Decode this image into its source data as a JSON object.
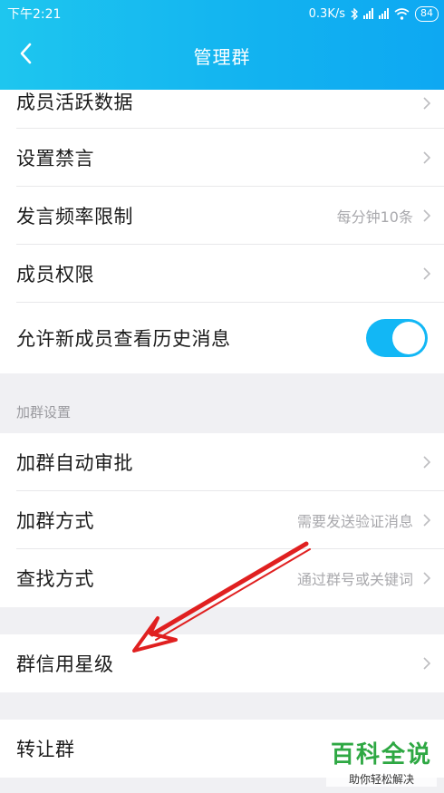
{
  "status": {
    "time": "下午2:21",
    "speed": "0.3K/s",
    "battery": "84"
  },
  "nav": {
    "title": "管理群"
  },
  "group1": {
    "items": [
      {
        "label": "成员活跃数据"
      },
      {
        "label": "设置禁言"
      },
      {
        "label": "发言频率限制",
        "value": "每分钟10条"
      },
      {
        "label": "成员权限"
      },
      {
        "label": "允许新成员查看历史消息",
        "toggle": "on"
      }
    ]
  },
  "section2": {
    "title": "加群设置",
    "items": [
      {
        "label": "加群自动审批"
      },
      {
        "label": "加群方式",
        "value": "需要发送验证消息"
      },
      {
        "label": "查找方式",
        "value": "通过群号或关键词"
      }
    ]
  },
  "group3": {
    "items": [
      {
        "label": "群信用星级"
      }
    ]
  },
  "group4": {
    "items": [
      {
        "label": "转让群"
      }
    ]
  },
  "watermark": {
    "title": "百科全说",
    "subtitle": "助你轻松解决"
  },
  "colors": {
    "header": "#12b2f0",
    "toggle_on": "#12b7f5",
    "annotation_arrow": "#e02020",
    "watermark": "#2ea843"
  }
}
